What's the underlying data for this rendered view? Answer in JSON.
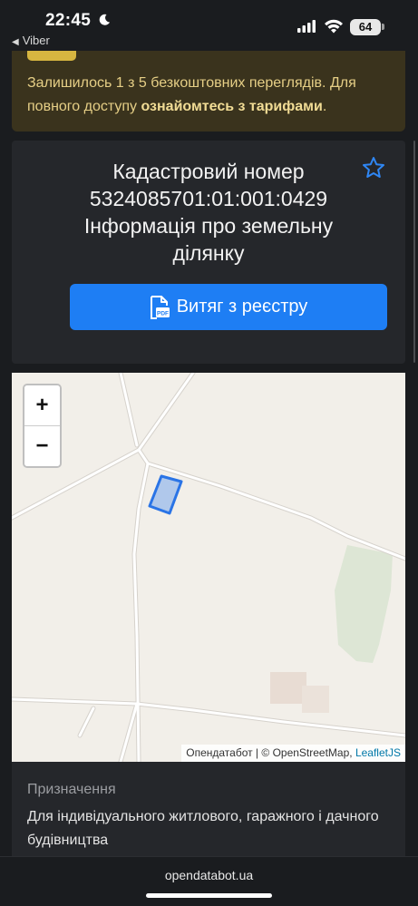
{
  "status_bar": {
    "time": "22:45",
    "back_app": "Viber",
    "battery": "64"
  },
  "notice": {
    "text": "Залишилось 1 з 5 безкоштовних переглядів. Для повного доступу ",
    "link": "ознайомтесь з тарифами",
    "suffix": "."
  },
  "card": {
    "title_line1": "Кадастровий номер",
    "title_line2": "5324085701:01:001:0429",
    "title_line3": "Інформація про земельну",
    "title_line4": "ділянку",
    "extract_button": "Витяг з реєстру"
  },
  "map": {
    "zoom_in": "+",
    "zoom_out": "−",
    "attribution_owner": "Опендатабот",
    "attribution_sep": " | © ",
    "attribution_osm": "OpenStreetMap",
    "attribution_comma": ", ",
    "attribution_leaflet": "LeafletJS"
  },
  "purpose": {
    "label": "Призначення",
    "value": "Для індивідуального житлового, гаражного і дачного будівництва"
  },
  "browser": {
    "url": "opendatabot.ua"
  },
  "colors": {
    "accent": "#1e7ef4",
    "notice_bg": "#3a331d",
    "notice_text": "#e6cf86",
    "parcel": "#2a74e6"
  },
  "icons": [
    "moon-icon",
    "signal-icon",
    "wifi-icon",
    "star-icon",
    "pdf-icon",
    "back-arrow-icon"
  ]
}
